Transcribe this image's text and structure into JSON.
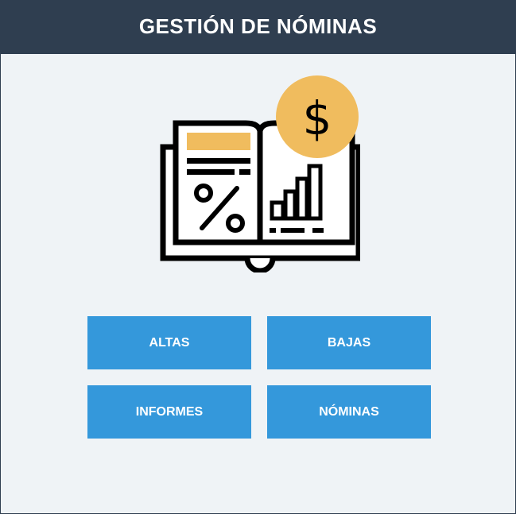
{
  "header": {
    "title": "GESTIÓN DE NÓMINAS"
  },
  "illustration": {
    "icon": "payroll-book-icon",
    "coin_icon": "dollar-coin-icon",
    "accent_color": "#f0bc5e",
    "line_color": "#000000"
  },
  "buttons": {
    "altas": "ALTAS",
    "bajas": "BAJAS",
    "informes": "INFORMES",
    "nominas": "NÓMINAS"
  },
  "colors": {
    "header_bg": "#2f3e50",
    "page_bg": "#eff3f6",
    "button_bg": "#3498db",
    "button_text": "#ffffff"
  }
}
